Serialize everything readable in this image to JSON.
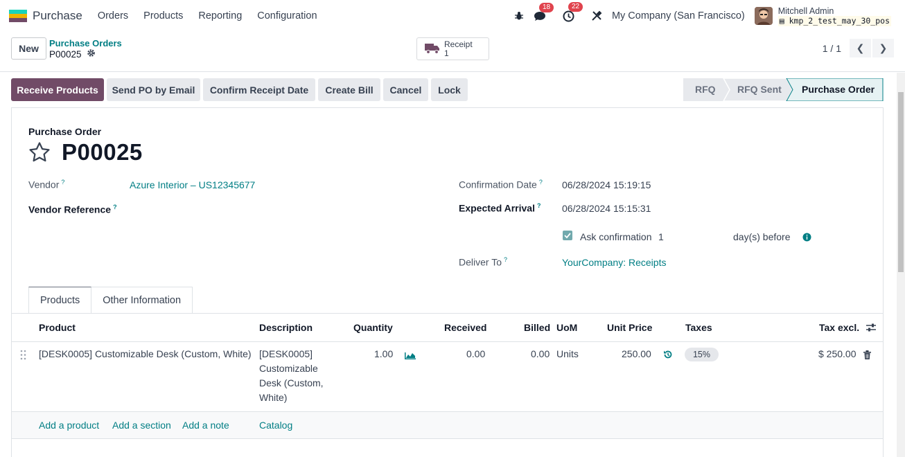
{
  "app": {
    "title": "Purchase",
    "logo_colors": [
      "#1ad3bb",
      "#f0b400",
      "#714b67",
      "#017e84"
    ],
    "menu": [
      "Orders",
      "Products",
      "Reporting",
      "Configuration"
    ]
  },
  "systray": {
    "bug_icon": "bug-icon",
    "messages_badge": "18",
    "activities_badge": "22",
    "tools_icon": "tools-icon",
    "company": "My Company (San Francisco)",
    "user_name": "Mitchell Admin",
    "db_name": "kmp_2_test_may_30_pos"
  },
  "control_panel": {
    "new_label": "New",
    "breadcrumb": "Purchase Orders",
    "record_name": "P00025",
    "smart_button": {
      "label": "Receipt",
      "count": "1"
    },
    "pager": "1 / 1"
  },
  "actions": {
    "receive": "Receive Products",
    "send_email": "Send PO by Email",
    "confirm_receipt": "Confirm Receipt Date",
    "create_bill": "Create Bill",
    "cancel": "Cancel",
    "lock": "Lock"
  },
  "statusbar": {
    "stages": [
      "RFQ",
      "RFQ Sent",
      "Purchase Order"
    ],
    "active": "Purchase Order"
  },
  "form": {
    "subtitle": "Purchase Order",
    "title": "P00025",
    "vendor_label": "Vendor",
    "vendor_value": "Azure Interior – US12345677",
    "vendor_ref_label": "Vendor Reference",
    "confirmation_date_label": "Confirmation Date",
    "confirmation_date_value": "06/28/2024 15:19:15",
    "expected_arrival_label": "Expected Arrival",
    "expected_arrival_value": "06/28/2024 15:15:31",
    "ask_confirmation_label": "Ask confirmation",
    "ask_confirmation_days": "1",
    "ask_confirmation_suffix": "day(s) before",
    "deliver_to_label": "Deliver To",
    "deliver_to_value": "YourCompany: Receipts"
  },
  "tabs": [
    "Products",
    "Other Information"
  ],
  "lines_table": {
    "headers": {
      "product": "Product",
      "description": "Description",
      "quantity": "Quantity",
      "received": "Received",
      "billed": "Billed",
      "uom": "UoM",
      "unit_price": "Unit Price",
      "taxes": "Taxes",
      "tax_excl": "Tax excl."
    },
    "rows": [
      {
        "product": "[DESK0005] Customizable Desk (Custom, White)",
        "description": [
          "[DESK0005]",
          "Customizable",
          "Desk (Custom,",
          "White)"
        ],
        "quantity": "1.00",
        "received": "0.00",
        "billed": "0.00",
        "uom": "Units",
        "unit_price": "250.00",
        "tax": "15%",
        "tax_excl": "$ 250.00"
      }
    ],
    "add_links": [
      "Add a product",
      "Add a section",
      "Add a note",
      "Catalog"
    ]
  }
}
